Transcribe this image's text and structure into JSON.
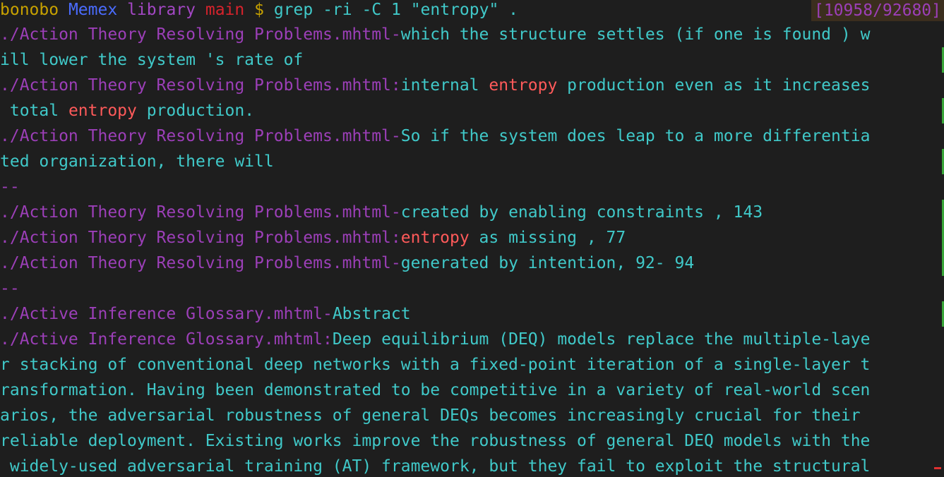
{
  "colors": {
    "background": "#1e1e1e",
    "prompt_user": "#c8a200",
    "prompt_dir1": "#4a6cff",
    "prompt_dir2": "#a347c4",
    "prompt_branch": "#d7232c",
    "prompt_symbol": "#c8a200",
    "command": "#40c9c9",
    "filename": "#9c3fb8",
    "separator": "#9c3fb8",
    "text": "#40c9c9",
    "match": "#ff5a5a",
    "counter": "#9c3fb8"
  },
  "prompt": {
    "user": "bonobo",
    "dir1": "Memex",
    "dir2": "library",
    "branch": "main",
    "symbol": "$",
    "command": "grep -ri -C 1 \"entropy\" ."
  },
  "position_counter": "[10958/92680]",
  "lines": [
    {
      "segments": [
        {
          "t": "./Action Theory Resolving Problems.mhtml",
          "c": "filename"
        },
        {
          "t": "-",
          "c": "separator"
        },
        {
          "t": "which the structure settles (if one is found ) w",
          "c": "text"
        }
      ],
      "gutter": false
    },
    {
      "segments": [
        {
          "t": "ill lower the system 's rate of",
          "c": "text"
        }
      ],
      "gutter": true
    },
    {
      "segments": [
        {
          "t": "./Action Theory Resolving Problems.mhtml",
          "c": "filename"
        },
        {
          "t": ":",
          "c": "separator"
        },
        {
          "t": "internal ",
          "c": "text"
        },
        {
          "t": "entropy",
          "c": "match"
        },
        {
          "t": " production even as it increases",
          "c": "text"
        }
      ],
      "gutter": false
    },
    {
      "segments": [
        {
          "t": " total ",
          "c": "text"
        },
        {
          "t": "entropy",
          "c": "match"
        },
        {
          "t": " production.",
          "c": "text"
        }
      ],
      "gutter": true
    },
    {
      "segments": [
        {
          "t": "./Action Theory Resolving Problems.mhtml",
          "c": "filename"
        },
        {
          "t": "-",
          "c": "separator"
        },
        {
          "t": "So if the system does leap to a more differentia",
          "c": "text"
        }
      ],
      "gutter": false
    },
    {
      "segments": [
        {
          "t": "ted organization, there will",
          "c": "text"
        }
      ],
      "gutter": true
    },
    {
      "segments": [
        {
          "t": "--",
          "c": "separator"
        }
      ],
      "gutter": false
    },
    {
      "segments": [
        {
          "t": "./Action Theory Resolving Problems.mhtml",
          "c": "filename"
        },
        {
          "t": "-",
          "c": "separator"
        },
        {
          "t": "created by enabling constraints , 143",
          "c": "text"
        }
      ],
      "gutter": true
    },
    {
      "segments": [
        {
          "t": "./Action Theory Resolving Problems.mhtml",
          "c": "filename"
        },
        {
          "t": ":",
          "c": "separator"
        },
        {
          "t": "entropy",
          "c": "match"
        },
        {
          "t": " as missing , 77",
          "c": "text"
        }
      ],
      "gutter": true
    },
    {
      "segments": [
        {
          "t": "./Action Theory Resolving Problems.mhtml",
          "c": "filename"
        },
        {
          "t": "-",
          "c": "separator"
        },
        {
          "t": "generated by intention, 92- 94",
          "c": "text"
        }
      ],
      "gutter": true
    },
    {
      "segments": [
        {
          "t": "--",
          "c": "separator"
        }
      ],
      "gutter": false
    },
    {
      "segments": [
        {
          "t": "./Active Inference Glossary.mhtml",
          "c": "filename"
        },
        {
          "t": "-",
          "c": "separator"
        },
        {
          "t": "Abstract",
          "c": "text"
        }
      ],
      "gutter": true
    },
    {
      "segments": [
        {
          "t": "./Active Inference Glossary.mhtml",
          "c": "filename"
        },
        {
          "t": ":",
          "c": "separator"
        },
        {
          "t": "Deep equilibrium (DEQ) models replace the multiple-laye",
          "c": "text"
        }
      ],
      "gutter": false
    },
    {
      "segments": [
        {
          "t": "r stacking of conventional deep networks with a fixed-point iteration of a single-layer t",
          "c": "text"
        }
      ],
      "gutter": false
    },
    {
      "segments": [
        {
          "t": "ransformation. Having been demonstrated to be competitive in a variety of real-world scen",
          "c": "text"
        }
      ],
      "gutter": false
    },
    {
      "segments": [
        {
          "t": "arios, the adversarial robustness of general DEQs becomes increasingly crucial for their",
          "c": "text"
        }
      ],
      "gutter": false
    },
    {
      "segments": [
        {
          "t": "reliable deployment. Existing works improve the robustness of general DEQ models with the",
          "c": "text"
        }
      ],
      "gutter": false
    },
    {
      "segments": [
        {
          "t": " widely-used adversarial training (AT) framework, but they fail to exploit the structural",
          "c": "text"
        }
      ],
      "gutter": false
    }
  ]
}
